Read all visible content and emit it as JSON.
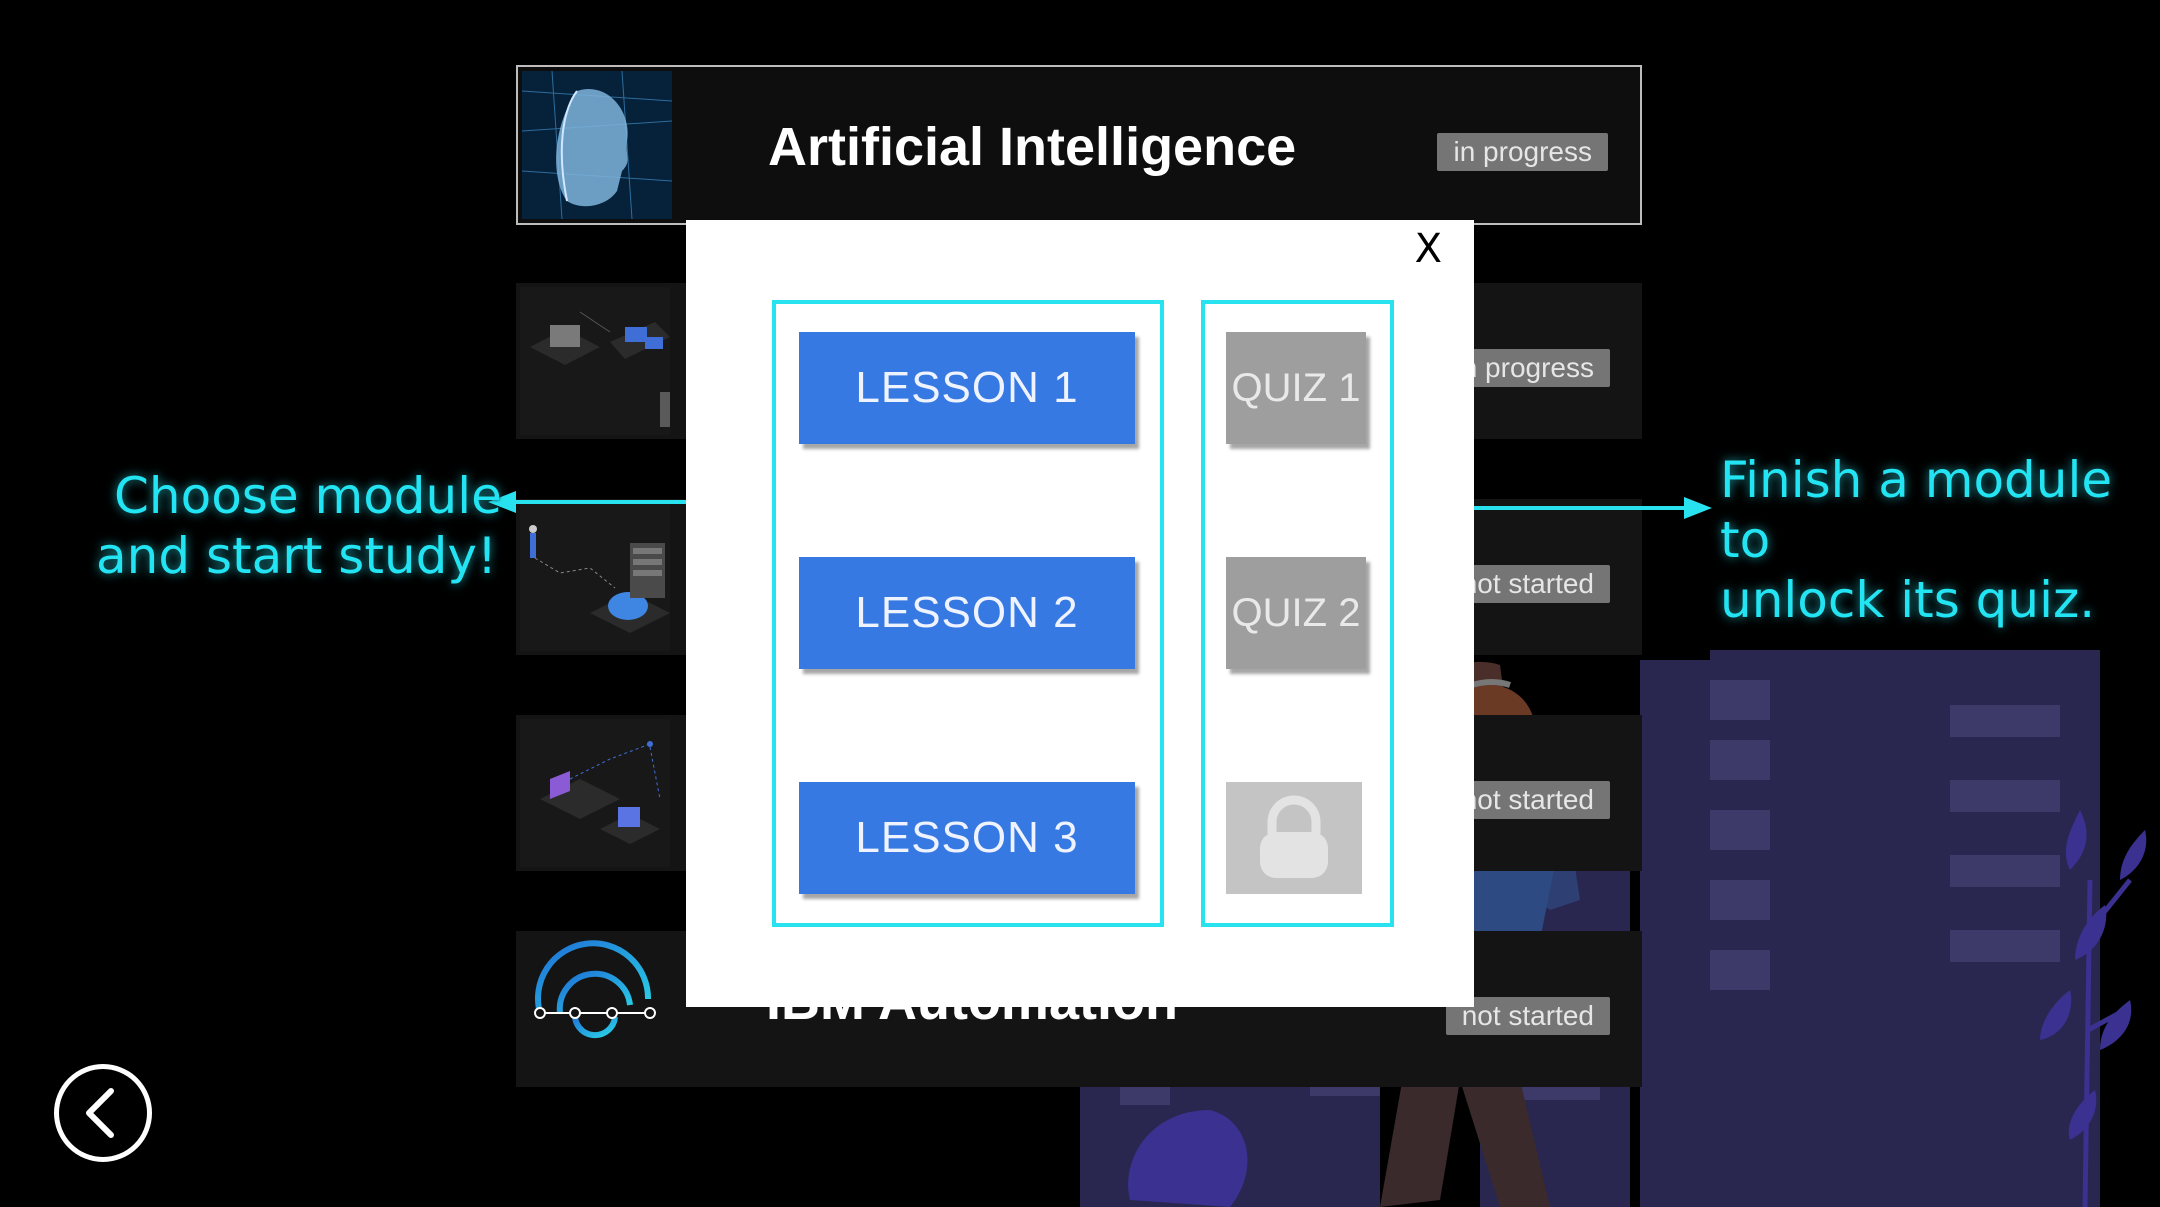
{
  "modules": [
    {
      "title": "Artificial Intelligence",
      "status": "in progress",
      "thumb_icon": "ai-face-icon"
    },
    {
      "title": "",
      "status": "in progress",
      "thumb_icon": "data-servers-icon"
    },
    {
      "title": "",
      "status": "not started",
      "thumb_icon": "cloud-servers-icon"
    },
    {
      "title": "",
      "status": "not started",
      "thumb_icon": "network-devices-icon"
    },
    {
      "title": "IBM Automation",
      "status": "not started",
      "thumb_icon": "automation-swirl-icon"
    }
  ],
  "modal": {
    "close_label": "X",
    "lessons": [
      "LESSON 1",
      "LESSON 2",
      "LESSON 3"
    ],
    "quizzes": [
      {
        "label": "QUIZ 1",
        "locked": false
      },
      {
        "label": "QUIZ 2",
        "locked": false
      },
      {
        "label": "",
        "locked": true,
        "icon": "lock-icon"
      }
    ]
  },
  "callouts": {
    "left_line1": "Choose module",
    "left_line2": "and start study!",
    "right_line1": "Finish a module to",
    "right_line2": "unlock its quiz."
  },
  "colors": {
    "accent_cyan": "#28e3ef",
    "lesson_blue": "#3779e3",
    "quiz_gray": "#9e9e9e",
    "status_badge": "#757575",
    "city_navy": "#292750"
  }
}
